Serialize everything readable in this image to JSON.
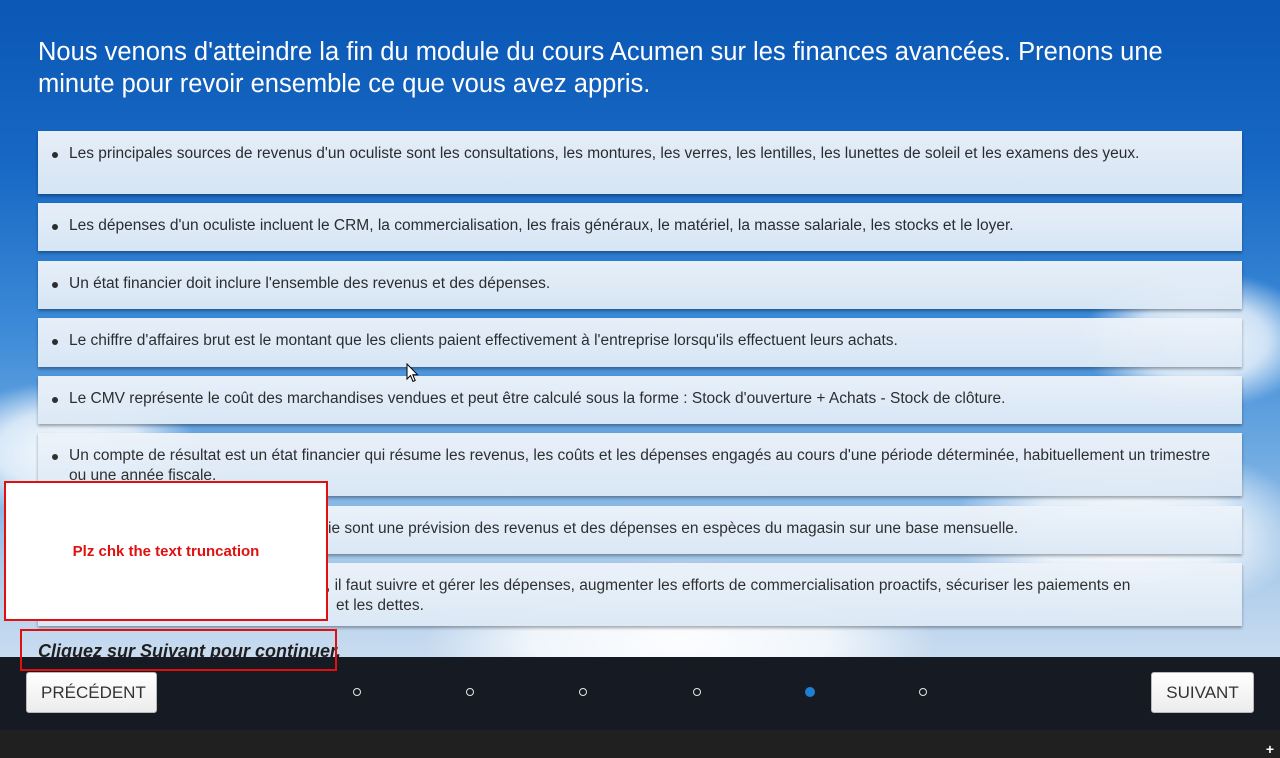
{
  "title": "Nous venons d'atteindre la fin du module du cours Acumen sur les finances avancées. Prenons une minute pour revoir ensemble ce que vous avez appris.",
  "items": [
    {
      "text": "Les principales sources de revenus d'un oculiste sont les consultations, les montures, les verres, les lentilles, les lunettes de soleil et les examens des yeux."
    },
    {
      "text": "Les dépenses d'un oculiste incluent le CRM, la commercialisation, les frais généraux, le matériel, la masse salariale, les stocks et le loyer."
    },
    {
      "text": "Un état financier doit inclure l'ensemble des revenus et des dépenses."
    },
    {
      "text": "Le chiffre d'affaires brut est le montant que les clients paient effectivement à l'entreprise lorsqu'ils effectuent leurs achats."
    },
    {
      "text": "Le CMV représente le coût des marchandises vendues et peut être calculé sous la forme : Stock d'ouverture + Achats - Stock de clôture."
    },
    {
      "text": "Un compte de résultat est un état financier qui résume les revenus, les coûts et les dépenses engagés au cours d'une période déterminée, habituellement un trimestre ou une année fiscale."
    },
    {
      "text": "ie sont une prévision des revenus et des dépenses en espèces du magasin sur une base mensuelle."
    },
    {
      "text": ", il faut suivre et gérer les dépenses, augmenter les efforts de commercialisation proactifs, sécuriser les paiements en",
      "text2": "et les dettes."
    }
  ],
  "comment": "Plz chk the text truncation",
  "continue_text": "Cliquez sur Suivant pour continuer.",
  "nav": {
    "prev_label": "PRÉCÉDENT",
    "next_label": "SUIVANT",
    "dots_total": 6,
    "active_dot": 5
  },
  "colors": {
    "accent": "#1e7fd4",
    "annotation_red": "#e01010",
    "navbar": "#161a22"
  },
  "icons": [
    "mouse-cursor-icon",
    "resize-grip-icon"
  ]
}
